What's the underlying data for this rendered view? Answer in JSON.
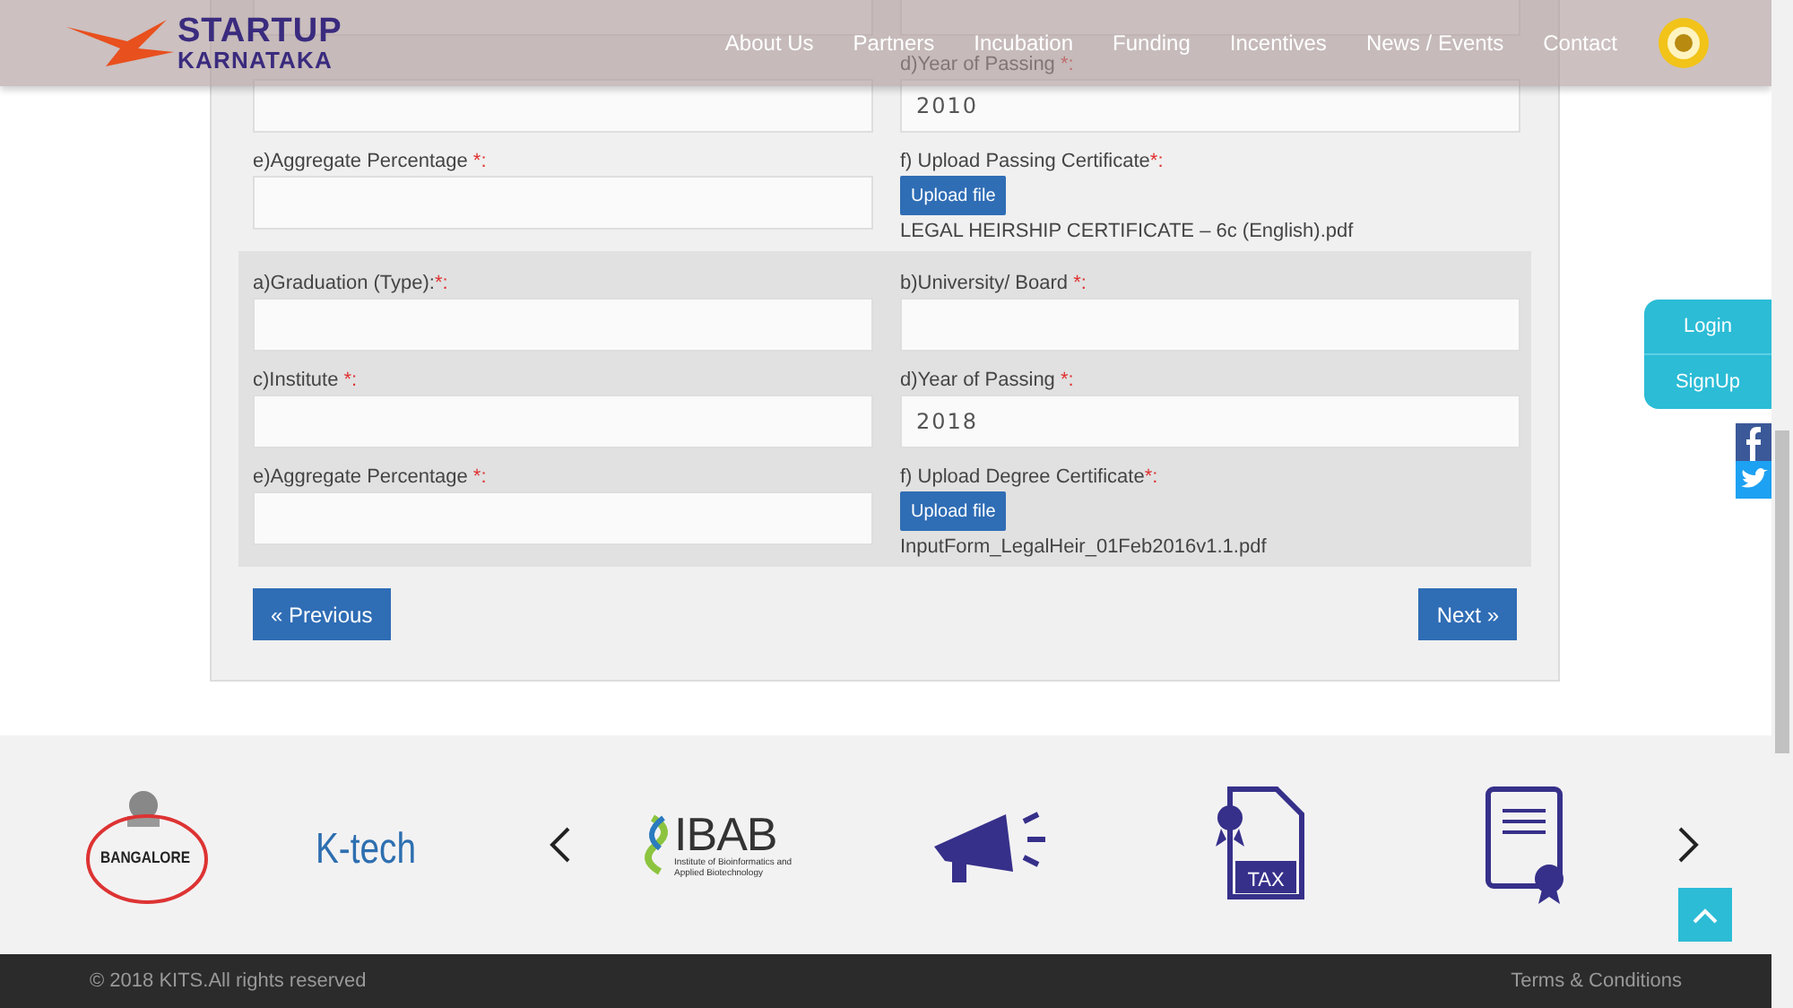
{
  "header": {
    "brand_top": "STARTUP",
    "brand_bottom": "KARNATAKA",
    "nav": [
      {
        "label": "About Us"
      },
      {
        "label": "Partners"
      },
      {
        "label": "Incubation"
      },
      {
        "label": "Funding"
      },
      {
        "label": "Incentives"
      },
      {
        "label": "News / Events"
      },
      {
        "label": "Contact"
      }
    ]
  },
  "sections": [
    {
      "shaded": false,
      "fields": [
        {
          "kind": "text"
        },
        {
          "kind": "text"
        },
        {
          "kind": "text"
        },
        {
          "kind": "text",
          "label": "d)Year of Passing ",
          "mark": "*",
          "after": ":",
          "value": "2010"
        },
        {
          "kind": "text",
          "label": "e)Aggregate Percentage ",
          "mark": "*",
          "after": ":"
        },
        {
          "kind": "upload",
          "label": "f) Upload Passing Certificate",
          "mark": "*",
          "after": ":",
          "button": "Upload file",
          "file": "LEGAL HEIRSHIP CERTIFICATE – 6c (English).pdf"
        }
      ]
    },
    {
      "shaded": true,
      "fields": [
        {
          "kind": "text",
          "label": "a)Graduation (Type):",
          "mark": "*",
          "after": ":"
        },
        {
          "kind": "text",
          "label": "b)University/ Board ",
          "mark": "*",
          "after": ":"
        },
        {
          "kind": "text",
          "label": "c)Institute ",
          "mark": "*",
          "after": ":"
        },
        {
          "kind": "text",
          "label": "d)Year of Passing ",
          "mark": "*",
          "after": ":",
          "value": "2018"
        },
        {
          "kind": "text",
          "label": "e)Aggregate Percentage ",
          "mark": "*",
          "after": ":"
        },
        {
          "kind": "upload",
          "label": "f) Upload Degree Certificate",
          "mark": "*",
          "after": ":",
          "button": "Upload file",
          "file": "InputForm_LegalHeir_01Feb2016v1.1.pdf"
        }
      ]
    }
  ],
  "previous": "« Previous",
  "next": "Next »",
  "side_panel": [
    {
      "label": "Login"
    },
    {
      "label": "SignUp"
    }
  ],
  "logos": [
    {
      "kind": "bangalore",
      "text": "BANGALORE"
    },
    {
      "kind": "ktech",
      "text": "K-tech"
    },
    {
      "kind": "ibab",
      "text": "IBAB",
      "caption": "Institute of Bioinformatics and Applied Biotechnology"
    },
    {
      "kind": "megaphone"
    },
    {
      "kind": "tax",
      "text": "TAX"
    },
    {
      "kind": "certificate"
    }
  ],
  "footer": {
    "copyright": "© 2018 KITS.All rights reserved",
    "terms": "Terms & Conditions"
  }
}
